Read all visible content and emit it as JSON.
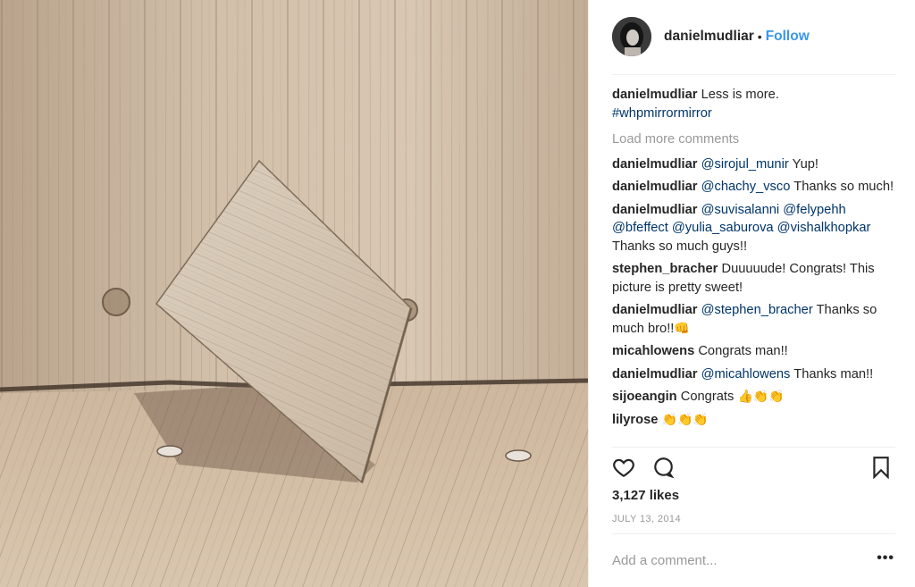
{
  "post": {
    "username": "danielmudliar",
    "follow_label": "Follow",
    "dot": "•"
  },
  "caption": {
    "username": "danielmudliar",
    "text": "Less is more.",
    "hashtag": "#whpmirrormirror"
  },
  "load_more_label": "Load more comments",
  "comments": [
    {
      "user": "danielmudliar",
      "mention": "@sirojul_munir",
      "text": " Yup!"
    },
    {
      "user": "danielmudliar",
      "mention": "@chachy_vsco",
      "text": " Thanks so much!"
    },
    {
      "user": "danielmudliar",
      "mention": "@suvisalanni @felypehh @bfeffect @yulia_saburova @vishalkhopkar",
      "text": " Thanks so much guys!!"
    },
    {
      "user": "stephen_bracher",
      "mention": "",
      "text": "Duuuuude! Congrats! This picture is pretty sweet!"
    },
    {
      "user": "danielmudliar",
      "mention": "@stephen_bracher",
      "text": " Thanks so much bro!!",
      "emoji": "👊"
    },
    {
      "user": "micahlowens",
      "mention": "",
      "text": "Congrats man!!"
    },
    {
      "user": "danielmudliar",
      "mention": "@micahlowens",
      "text": " Thanks man!!"
    },
    {
      "user": "sijoeangin",
      "mention": "",
      "text": "Congrats",
      "emoji": "👍👏👏"
    },
    {
      "user": "lilyrose",
      "mention": "",
      "text": "",
      "emoji": "👏👏👏"
    }
  ],
  "actions": {
    "like_icon": "heart-outline-icon",
    "comment_icon": "speech-bubble-icon",
    "save_icon": "bookmark-outline-icon"
  },
  "likes": "3,127 likes",
  "date": "JULY 13, 2014",
  "add_comment": {
    "placeholder": "Add a comment...",
    "more_label": "•••"
  },
  "colors": {
    "accent": "#3897f0",
    "link": "#003569",
    "muted": "#999999",
    "text": "#262626"
  }
}
